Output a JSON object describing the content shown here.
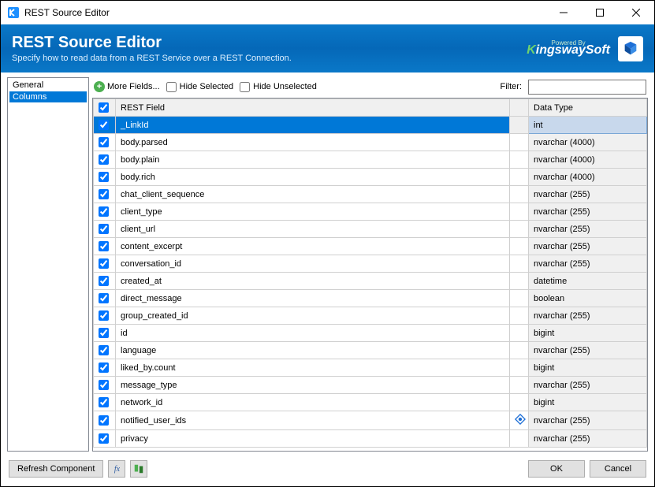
{
  "window": {
    "title": "REST Source Editor"
  },
  "banner": {
    "title": "REST Source Editor",
    "subtitle": "Specify how to read data from a REST Service over a REST Connection.",
    "powered_by": "Powered By",
    "brand_a": "K",
    "brand_b": "ingswaySoft"
  },
  "sidebar": {
    "items": [
      {
        "label": "General",
        "selected": false
      },
      {
        "label": "Columns",
        "selected": true
      }
    ]
  },
  "toolbar": {
    "more_fields": "More Fields...",
    "hide_selected": "Hide Selected",
    "hide_unselected": "Hide Unselected",
    "filter_label": "Filter:",
    "filter_value": ""
  },
  "grid": {
    "header_field": "REST Field",
    "header_type": "Data Type",
    "rows": [
      {
        "field": "_LinkId",
        "type": "int",
        "selected": true
      },
      {
        "field": "body.parsed",
        "type": "nvarchar (4000)"
      },
      {
        "field": "body.plain",
        "type": "nvarchar (4000)"
      },
      {
        "field": "body.rich",
        "type": "nvarchar (4000)"
      },
      {
        "field": "chat_client_sequence",
        "type": "nvarchar (255)"
      },
      {
        "field": "client_type",
        "type": "nvarchar (255)"
      },
      {
        "field": "client_url",
        "type": "nvarchar (255)"
      },
      {
        "field": "content_excerpt",
        "type": "nvarchar (255)"
      },
      {
        "field": "conversation_id",
        "type": "nvarchar (255)"
      },
      {
        "field": "created_at",
        "type": "datetime"
      },
      {
        "field": "direct_message",
        "type": "boolean"
      },
      {
        "field": "group_created_id",
        "type": "nvarchar (255)"
      },
      {
        "field": "id",
        "type": "bigint"
      },
      {
        "field": "language",
        "type": "nvarchar (255)"
      },
      {
        "field": "liked_by.count",
        "type": "bigint"
      },
      {
        "field": "message_type",
        "type": "nvarchar (255)"
      },
      {
        "field": "network_id",
        "type": "bigint"
      },
      {
        "field": "notified_user_ids",
        "type": "nvarchar (255)",
        "link": true
      },
      {
        "field": "privacy",
        "type": "nvarchar (255)"
      }
    ]
  },
  "footer": {
    "refresh": "Refresh Component",
    "ok": "OK",
    "cancel": "Cancel"
  }
}
